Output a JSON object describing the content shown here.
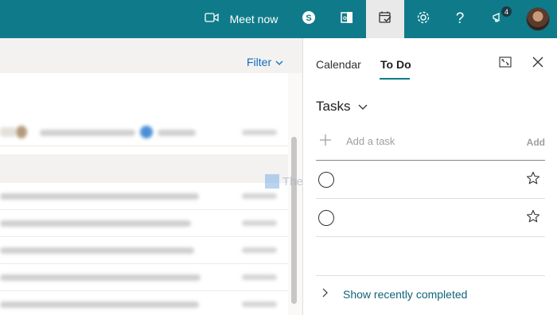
{
  "topbar": {
    "meet_now_label": "Meet now",
    "notification_count": "4",
    "icons": [
      "video-camera-icon",
      "skype-icon",
      "office-icon",
      "calendar-check-icon",
      "gear-icon",
      "help-icon",
      "megaphone-icon"
    ],
    "bg_color": "#0f7b8a"
  },
  "mail": {
    "filter_label": "Filter"
  },
  "watermark": {
    "text": "TheWindowsClub"
  },
  "panel": {
    "tabs": [
      {
        "label": "Calendar",
        "active": false
      },
      {
        "label": "To Do",
        "active": true
      }
    ],
    "tasks_title": "Tasks",
    "add_task_placeholder": "Add a task",
    "add_button": "Add",
    "tasks": [
      {
        "title": ""
      },
      {
        "title": ""
      }
    ],
    "show_completed_label": "Show recently completed"
  }
}
